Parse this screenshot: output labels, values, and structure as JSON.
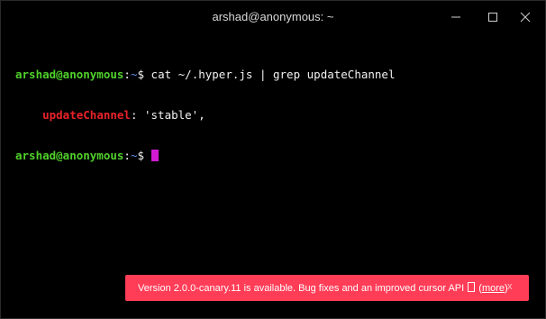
{
  "window": {
    "title": "arshad@anonymous: ~"
  },
  "terminal": {
    "line1": {
      "user": "arshad@anonymous",
      "sep": ":",
      "path": "~",
      "prompt": "$ ",
      "command": "cat ~/.hyper.js | grep updateChannel"
    },
    "line2": {
      "indent": "    ",
      "key": "updateChannel",
      "rest": ": 'stable',"
    },
    "line3": {
      "user": "arshad@anonymous",
      "sep": ":",
      "path": "~",
      "prompt": "$ "
    }
  },
  "notification": {
    "message": "Version 2.0.0-canary.11 is available. Bug fixes and an improved cursor API ",
    "open_paren": " (",
    "link": "more",
    "close_paren": ")",
    "close": "x"
  },
  "colors": {
    "user": "#4fd02a",
    "path": "#5f8de8",
    "key": "#e8222a",
    "cursor": "#d21ad2",
    "notification_bg": "#ff3d57"
  }
}
